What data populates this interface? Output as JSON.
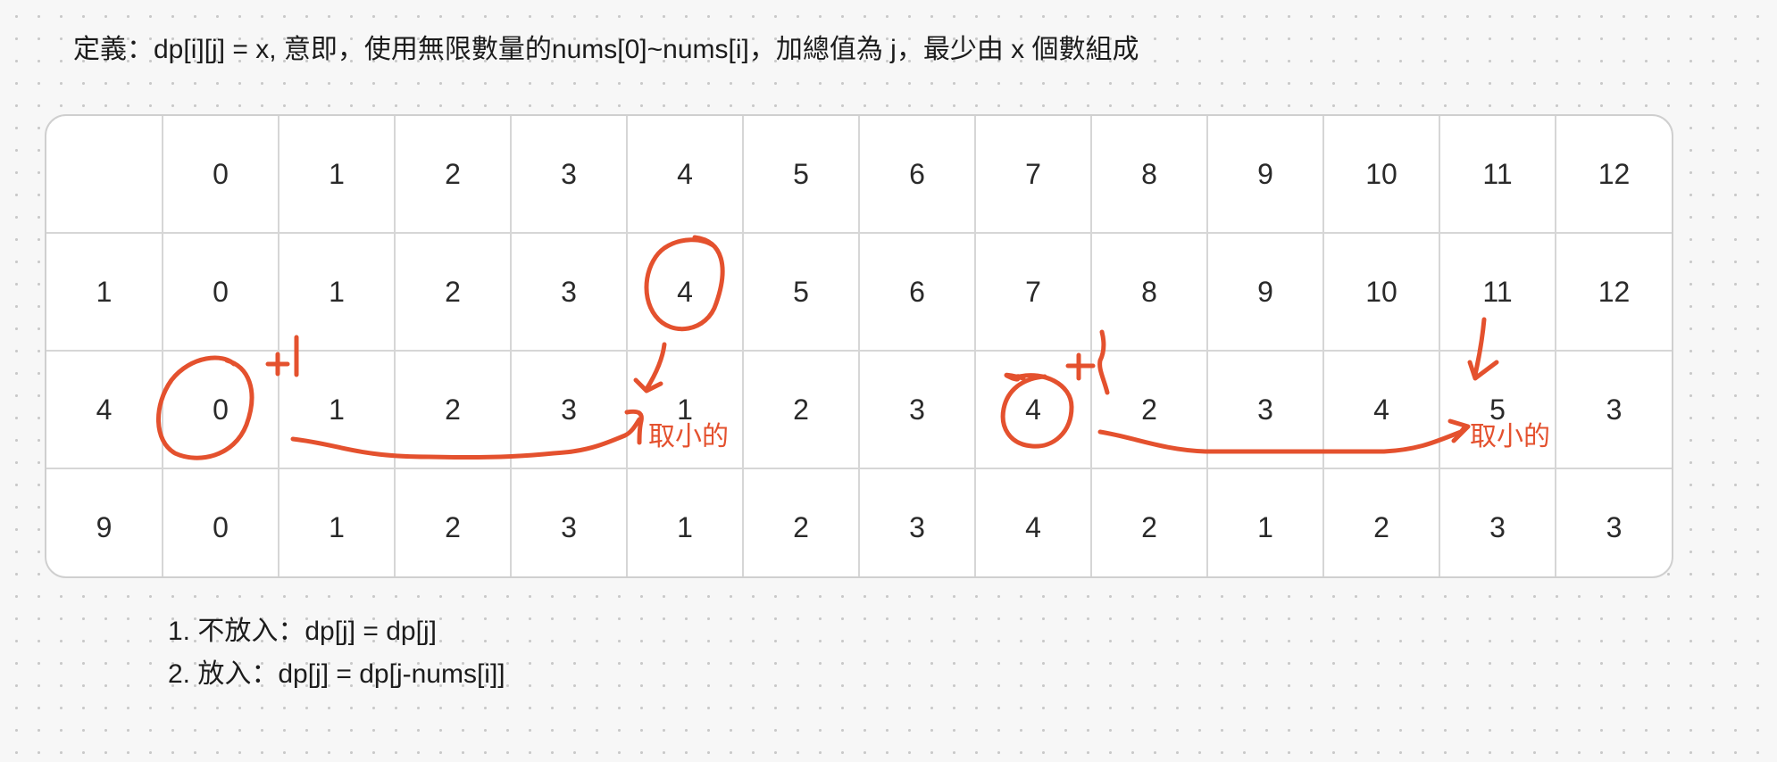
{
  "definition": "定義：dp[i][j] = x, 意即，使用無限數量的nums[0]~nums[i]，加總值為 j，最少由 x 個數組成",
  "table": {
    "header": [
      "",
      "0",
      "1",
      "2",
      "3",
      "4",
      "5",
      "6",
      "7",
      "8",
      "9",
      "10",
      "11",
      "12"
    ],
    "rows": [
      [
        "1",
        "0",
        "1",
        "2",
        "3",
        "4",
        "5",
        "6",
        "7",
        "8",
        "9",
        "10",
        "11",
        "12"
      ],
      [
        "4",
        "0",
        "1",
        "2",
        "3",
        "1",
        "2",
        "3",
        "4",
        "2",
        "3",
        "4",
        "5",
        "3"
      ],
      [
        "9",
        "0",
        "1",
        "2",
        "3",
        "1",
        "2",
        "3",
        "4",
        "2",
        "1",
        "2",
        "3",
        "3"
      ]
    ]
  },
  "annotations": {
    "color": "#e4512e",
    "plus_one_left": "+|",
    "plus_one_right": "+|",
    "take_min_left": "取小的",
    "take_min_right": "取小的"
  },
  "notes": [
    "1. 不放入：dp[j] = dp[j]",
    "2. 放入：dp[j] = dp[j-nums[i]]"
  ]
}
